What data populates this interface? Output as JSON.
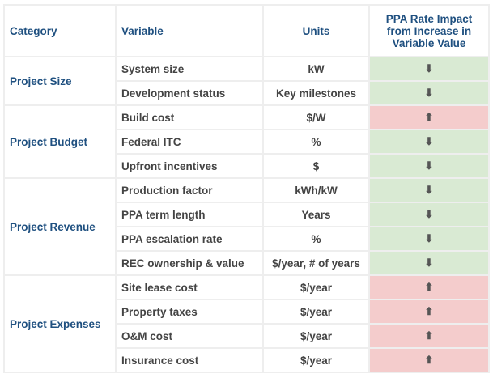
{
  "colors": {
    "header_text": "#1f5080",
    "increase": "#f4cccc",
    "decrease": "#d9ead3"
  },
  "headers": [
    "Category",
    "Variable",
    "Units",
    "PPA Rate Impact from Increase in Variable Value"
  ],
  "groups": [
    {
      "category": "Project Size",
      "rows": [
        {
          "variable": "System size",
          "units": "kW",
          "impact": "down"
        },
        {
          "variable": "Development status",
          "units": "Key milestones",
          "impact": "down"
        }
      ]
    },
    {
      "category": "Project Budget",
      "rows": [
        {
          "variable": "Build cost",
          "units": "$/W",
          "impact": "up"
        },
        {
          "variable": "Federal ITC",
          "units": "%",
          "impact": "down"
        },
        {
          "variable": "Upfront incentives",
          "units": "$",
          "impact": "down"
        }
      ]
    },
    {
      "category": "Project Revenue",
      "rows": [
        {
          "variable": "Production factor",
          "units": "kWh/kW",
          "impact": "down"
        },
        {
          "variable": "PPA term length",
          "units": "Years",
          "impact": "down"
        },
        {
          "variable": "PPA escalation rate",
          "units": "%",
          "impact": "down"
        },
        {
          "variable": "REC ownership & value",
          "units": "$/year, # of years",
          "impact": "down"
        }
      ]
    },
    {
      "category": "Project Expenses",
      "rows": [
        {
          "variable": "Site lease cost",
          "units": "$/year",
          "impact": "up"
        },
        {
          "variable": "Property taxes",
          "units": "$/year",
          "impact": "up"
        },
        {
          "variable": "O&M cost",
          "units": "$/year",
          "impact": "up"
        },
        {
          "variable": "Insurance cost",
          "units": "$/year",
          "impact": "up"
        }
      ]
    }
  ]
}
